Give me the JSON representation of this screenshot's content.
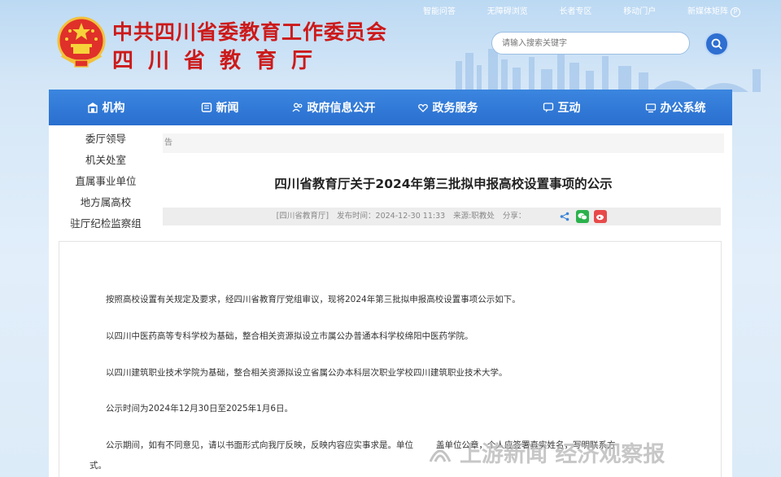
{
  "header": {
    "title": "中共四川省委教育工作委员会",
    "subtitle": "四川省教育厅",
    "top_links": [
      "智能问答",
      "无障碍浏览",
      "长者专区",
      "移动门户",
      "新媒体矩阵"
    ],
    "search_placeholder": "请输入搜索关键字"
  },
  "nav": {
    "items": [
      {
        "label": "机构",
        "icon": "building-icon"
      },
      {
        "label": "新闻",
        "icon": "news-icon"
      },
      {
        "label": "政府信息公开",
        "icon": "people-icon"
      },
      {
        "label": "政务服务",
        "icon": "heart-hands-icon"
      },
      {
        "label": "互动",
        "icon": "chat-icon"
      },
      {
        "label": "办公系统",
        "icon": "system-icon"
      }
    ]
  },
  "sidebar": {
    "items": [
      "委厅领导",
      "机关处室",
      "直属事业单位",
      "地方属高校",
      "驻厅纪检监察组"
    ]
  },
  "breadcrumb": "告",
  "article": {
    "title": "四川省教育厅关于2024年第三批拟申报高校设置事项的公示",
    "meta_source": "[四川省教育厅]",
    "meta_time": "发布时间：2024-12-30 11:33",
    "meta_from": "来源:职教处",
    "share_label": "分享：",
    "paragraphs": [
      "按照高校设置有关规定及要求，经四川省教育厅党组审议，现将2024年第三批拟申报高校设置事项公示如下。",
      "以四川中医药高等专科学校为基础，整合相关资源拟设立市属公办普通本科学校绵阳中医药学院。",
      "以四川建筑职业技术学院为基础，整合相关资源拟设立省属公办本科层次职业学校四川建筑职业技术大学。",
      "公示时间为2024年12月30日至2025年1月6日。",
      "公示期间，如有不同意见，请以书面形式向我厅反映，反映内容应实事求是。单位",
      "式。"
    ],
    "para5_tail": "盖单位公章，个人应签署真实姓名，写明联系方"
  },
  "watermark": "上游新闻 经济观察报",
  "colors": {
    "brand_red": "#cc1a1a",
    "nav_blue": "#2a6fcf"
  }
}
